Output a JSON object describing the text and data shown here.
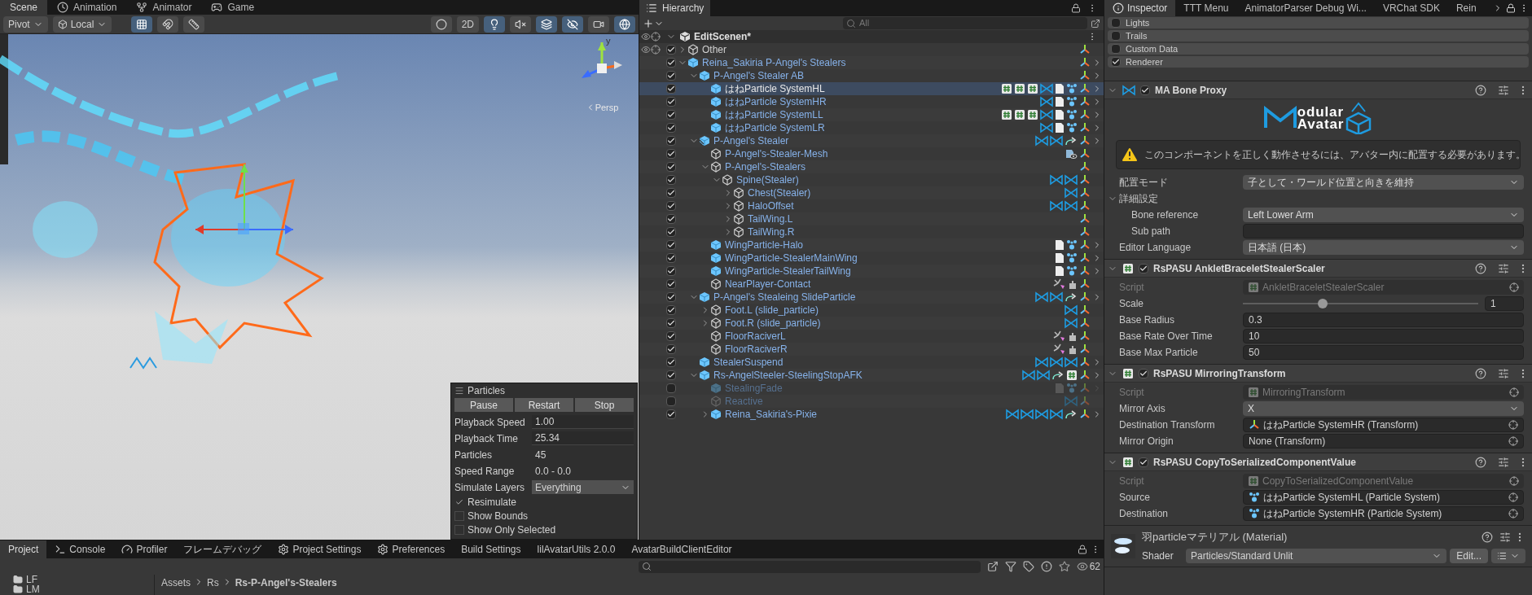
{
  "scene_view": {
    "tabs": [
      {
        "label": "Scene",
        "selected": true
      },
      {
        "label": "Animation",
        "selected": false
      },
      {
        "label": "Animator",
        "selected": false
      },
      {
        "label": "Game",
        "selected": false
      }
    ],
    "pivot": "Pivot",
    "space": "Local",
    "left_tools": [
      {
        "kind": "grid",
        "selected": true
      },
      {
        "kind": "snap",
        "selected": false
      },
      {
        "kind": "ruler",
        "selected": false
      }
    ],
    "right_tools": [
      {
        "kind": "shading",
        "selected": false
      },
      {
        "kind": "mode",
        "label": "2D",
        "selected": false
      },
      {
        "kind": "light",
        "selected": true
      },
      {
        "kind": "audio",
        "selected": false
      },
      {
        "kind": "effects",
        "selected": true
      },
      {
        "kind": "hidden",
        "selected": true
      },
      {
        "kind": "camera",
        "selected": false
      },
      {
        "kind": "gizmos",
        "selected": true
      }
    ],
    "gizmo": {
      "axis": "y",
      "projection": "Persp"
    },
    "particles_panel": {
      "title": "Particles",
      "buttons": [
        "Pause",
        "Restart",
        "Stop"
      ],
      "rows": [
        {
          "kind": "field",
          "label": "Playback Speed",
          "value": "1.00"
        },
        {
          "kind": "field",
          "label": "Playback Time",
          "value": "25.34"
        },
        {
          "kind": "text",
          "label": "Particles",
          "value": "45"
        },
        {
          "kind": "text",
          "label": "Speed Range",
          "value": "0.0 - 0.0"
        },
        {
          "kind": "dropdown",
          "label": "Simulate Layers",
          "value": "Everything"
        }
      ],
      "options": [
        {
          "label": "Resimulate",
          "checked": true
        },
        {
          "label": "Show Bounds",
          "checked": false
        },
        {
          "label": "Show Only Selected",
          "checked": false
        }
      ]
    }
  },
  "hierarchy": {
    "tab": "Hierarchy",
    "search": {
      "placeholder": "All"
    },
    "scene": {
      "name": "EditScenen*",
      "expanded": true,
      "children": [
        {
          "name": "Other",
          "kind": "object",
          "linked": false,
          "active": true,
          "selected": false,
          "expanded": false,
          "components": [
            {
              "kind": "transform"
            }
          ]
        },
        {
          "name": "Reina_Sakiria P-Angel's Stealers",
          "kind": "prefab",
          "linked": true,
          "active": true,
          "selected": false,
          "expanded": true,
          "components": [
            {
              "kind": "transform"
            }
          ],
          "children": [
            {
              "name": "P-Angel's Stealer AB",
              "kind": "prefab",
              "linked": true,
              "active": true,
              "selected": false,
              "expanded": true,
              "components": [
                {
                  "kind": "transform"
                }
              ],
              "children": [
                {
                  "name": "はねParticle SystemHL",
                  "kind": "prefab",
                  "linked": true,
                  "active": true,
                  "selected": true,
                  "components": [
                    {
                      "kind": "script"
                    },
                    {
                      "kind": "script"
                    },
                    {
                      "kind": "script"
                    },
                    {
                      "kind": "ma"
                    },
                    {
                      "kind": "doc"
                    },
                    {
                      "kind": "particle"
                    },
                    {
                      "kind": "transform"
                    }
                  ]
                },
                {
                  "name": "はねParticle SystemHR",
                  "kind": "prefab",
                  "linked": true,
                  "active": true,
                  "selected": false,
                  "components": [
                    {
                      "kind": "ma"
                    },
                    {
                      "kind": "doc"
                    },
                    {
                      "kind": "particle"
                    },
                    {
                      "kind": "transform"
                    }
                  ]
                },
                {
                  "name": "はねParticle SystemLL",
                  "kind": "prefab",
                  "linked": true,
                  "active": true,
                  "selected": false,
                  "components": [
                    {
                      "kind": "script"
                    },
                    {
                      "kind": "script"
                    },
                    {
                      "kind": "script"
                    },
                    {
                      "kind": "ma"
                    },
                    {
                      "kind": "doc"
                    },
                    {
                      "kind": "particle"
                    },
                    {
                      "kind": "transform"
                    }
                  ]
                },
                {
                  "name": "はねParticle SystemLR",
                  "kind": "prefab",
                  "linked": true,
                  "active": true,
                  "selected": false,
                  "components": [
                    {
                      "kind": "ma"
                    },
                    {
                      "kind": "doc"
                    },
                    {
                      "kind": "particle"
                    },
                    {
                      "kind": "transform"
                    }
                  ]
                }
              ]
            },
            {
              "name": "P-Angel's Stealer",
              "kind": "variant",
              "linked": true,
              "active": true,
              "selected": false,
              "expanded": true,
              "components": [
                {
                  "kind": "ma"
                },
                {
                  "kind": "ma"
                },
                {
                  "kind": "constraint"
                },
                {
                  "kind": "transform"
                }
              ],
              "children": [
                {
                  "name": "P-Angel's-Stealer-Mesh",
                  "kind": "object",
                  "linked": true,
                  "active": true,
                  "selected": false,
                  "components": [
                    {
                      "kind": "renderer"
                    },
                    {
                      "kind": "transform"
                    }
                  ]
                },
                {
                  "name": "P-Angel's-Stealers",
                  "kind": "object",
                  "linked": true,
                  "active": true,
                  "selected": false,
                  "expanded": true,
                  "components": [
                    {
                      "kind": "transform"
                    }
                  ],
                  "children": [
                    {
                      "name": "Spine(Stealer)",
                      "kind": "object",
                      "linked": true,
                      "active": true,
                      "selected": false,
                      "expanded": true,
                      "components": [
                        {
                          "kind": "ma"
                        },
                        {
                          "kind": "ma"
                        },
                        {
                          "kind": "transform"
                        }
                      ],
                      "children": [
                        {
                          "name": "Chest(Stealer)",
                          "kind": "object",
                          "linked": true,
                          "active": true,
                          "selected": false,
                          "expanded": false,
                          "components": [
                            {
                              "kind": "ma"
                            },
                            {
                              "kind": "transform"
                            }
                          ]
                        },
                        {
                          "name": "HaloOffset",
                          "kind": "object",
                          "linked": true,
                          "active": true,
                          "selected": false,
                          "expanded": false,
                          "components": [
                            {
                              "kind": "ma"
                            },
                            {
                              "kind": "ma"
                            },
                            {
                              "kind": "transform"
                            }
                          ]
                        },
                        {
                          "name": "TailWing.L",
                          "kind": "object",
                          "linked": true,
                          "active": true,
                          "selected": false,
                          "expanded": false,
                          "components": [
                            {
                              "kind": "transform"
                            }
                          ]
                        },
                        {
                          "name": "TailWing.R",
                          "kind": "object",
                          "linked": true,
                          "active": true,
                          "selected": false,
                          "expanded": false,
                          "components": [
                            {
                              "kind": "transform"
                            }
                          ]
                        }
                      ]
                    }
                  ]
                },
                {
                  "name": "WingParticle-Halo",
                  "kind": "prefab",
                  "linked": true,
                  "active": true,
                  "selected": false,
                  "components": [
                    {
                      "kind": "doc"
                    },
                    {
                      "kind": "particle"
                    },
                    {
                      "kind": "transform"
                    }
                  ]
                },
                {
                  "name": "WingParticle-StealerMainWing",
                  "kind": "prefab",
                  "linked": true,
                  "active": true,
                  "selected": false,
                  "components": [
                    {
                      "kind": "doc"
                    },
                    {
                      "kind": "particle"
                    },
                    {
                      "kind": "transform"
                    }
                  ]
                },
                {
                  "name": "WingParticle-StealerTailWing",
                  "kind": "prefab",
                  "linked": true,
                  "active": true,
                  "selected": false,
                  "components": [
                    {
                      "kind": "doc"
                    },
                    {
                      "kind": "particle"
                    },
                    {
                      "kind": "transform"
                    }
                  ]
                },
                {
                  "name": "NearPlayer-Contact",
                  "kind": "object",
                  "linked": true,
                  "active": true,
                  "selected": false,
                  "components": [
                    {
                      "kind": "contact"
                    },
                    {
                      "kind": "puzzle"
                    },
                    {
                      "kind": "transform"
                    }
                  ]
                }
              ]
            },
            {
              "name": "P-Angel's Stealeing SlideParticle",
              "kind": "prefab",
              "linked": true,
              "active": true,
              "selected": false,
              "expanded": true,
              "components": [
                {
                  "kind": "ma"
                },
                {
                  "kind": "ma"
                },
                {
                  "kind": "constraint"
                },
                {
                  "kind": "transform"
                }
              ],
              "children": [
                {
                  "name": "Foot.L (slide_particle)",
                  "kind": "object",
                  "linked": true,
                  "active": true,
                  "selected": false,
                  "expanded": false,
                  "components": [
                    {
                      "kind": "ma"
                    },
                    {
                      "kind": "transform"
                    }
                  ]
                },
                {
                  "name": "Foot.R (slide_particle)",
                  "kind": "object",
                  "linked": true,
                  "active": true,
                  "selected": false,
                  "expanded": false,
                  "components": [
                    {
                      "kind": "ma"
                    },
                    {
                      "kind": "transform"
                    }
                  ]
                },
                {
                  "name": "FloorRaciverL",
                  "kind": "object",
                  "linked": true,
                  "active": true,
                  "selected": false,
                  "components": [
                    {
                      "kind": "contact"
                    },
                    {
                      "kind": "puzzle"
                    },
                    {
                      "kind": "transform"
                    }
                  ]
                },
                {
                  "name": "FloorRaciverR",
                  "kind": "object",
                  "linked": true,
                  "active": true,
                  "selected": false,
                  "components": [
                    {
                      "kind": "contact"
                    },
                    {
                      "kind": "puzzle"
                    },
                    {
                      "kind": "transform"
                    }
                  ]
                }
              ]
            },
            {
              "name": "StealerSuspend",
              "kind": "prefab",
              "linked": true,
              "active": true,
              "selected": false,
              "components": [
                {
                  "kind": "ma"
                },
                {
                  "kind": "ma"
                },
                {
                  "kind": "ma"
                },
                {
                  "kind": "transform"
                }
              ]
            },
            {
              "name": "Rs-AngelSteeler-SteelingStopAFK",
              "kind": "prefab",
              "linked": true,
              "active": true,
              "selected": false,
              "expanded": true,
              "components": [
                {
                  "kind": "ma"
                },
                {
                  "kind": "ma"
                },
                {
                  "kind": "constraint"
                },
                {
                  "kind": "script"
                },
                {
                  "kind": "transform"
                }
              ],
              "children": [
                {
                  "name": "StealingFade",
                  "kind": "prefab",
                  "linked": true,
                  "active": false,
                  "selected": false,
                  "components": [
                    {
                      "kind": "doc"
                    },
                    {
                      "kind": "particle"
                    },
                    {
                      "kind": "transform"
                    }
                  ]
                },
                {
                  "name": "Reactive",
                  "kind": "object",
                  "linked": true,
                  "active": false,
                  "selected": false,
                  "components": [
                    {
                      "kind": "ma"
                    },
                    {
                      "kind": "transform"
                    }
                  ]
                },
                {
                  "name": "Reina_Sakiria's-Pixie",
                  "kind": "prefab",
                  "linked": true,
                  "active": true,
                  "selected": false,
                  "expanded": false,
                  "components": [
                    {
                      "kind": "ma"
                    },
                    {
                      "kind": "ma"
                    },
                    {
                      "kind": "ma"
                    },
                    {
                      "kind": "ma"
                    },
                    {
                      "kind": "constraint"
                    },
                    {
                      "kind": "transform"
                    }
                  ]
                }
              ]
            }
          ]
        }
      ]
    }
  },
  "inspector": {
    "tabs": [
      {
        "label": "Inspector",
        "selected": true
      },
      {
        "label": "TTT Menu",
        "selected": false
      },
      {
        "label": "AnimatorParser Debug Wi...",
        "selected": false
      },
      {
        "label": "VRChat SDK",
        "selected": false
      },
      {
        "label": "Rein",
        "selected": false
      }
    ],
    "modules": [
      {
        "label": "Lights",
        "checked": false
      },
      {
        "label": "Trails",
        "checked": false
      },
      {
        "label": "Custom Data",
        "checked": false
      },
      {
        "label": "Renderer",
        "checked": true
      }
    ],
    "components": [
      {
        "kind": "ma",
        "title": "MA Bone Proxy",
        "enabled": true,
        "logo": {
          "line_1": "odular",
          "line_2": "Avatar"
        },
        "warning": "このコンポーネントを正しく動作させるには、アバター内に配置する必要があります。",
        "fields": [
          {
            "kind": "dropdown",
            "label": "配置モード",
            "value": "子として・ワールド位置と向きを維持"
          },
          {
            "kind": "foldout",
            "label": "詳細設定",
            "expanded": true,
            "children": [
              {
                "kind": "dropdown",
                "label": "Bone reference",
                "value": "Left Lower Arm"
              },
              {
                "kind": "text",
                "label": "Sub path"
              }
            ]
          },
          {
            "kind": "dropdown",
            "label": "Editor Language",
            "value": "日本語 (日本)"
          }
        ]
      },
      {
        "kind": "script",
        "title": "RsPASU AnkletBraceletStealerScaler",
        "enabled": true,
        "fields": [
          {
            "kind": "script",
            "label": "Script",
            "value": "AnkletBraceletStealerScaler"
          },
          {
            "kind": "slider",
            "label": "Scale",
            "level": 0.34,
            "value": "1"
          },
          {
            "kind": "text",
            "label": "Base Radius",
            "value": "0.3"
          },
          {
            "kind": "text",
            "label": "Base Rate Over Time",
            "value": "10"
          },
          {
            "kind": "text",
            "label": "Base Max Particle",
            "value": "50"
          }
        ]
      },
      {
        "kind": "script",
        "title": "RsPASU MirroringTransform",
        "enabled": true,
        "fields": [
          {
            "kind": "script",
            "label": "Script",
            "value": "MirroringTransform"
          },
          {
            "kind": "dropdown",
            "label": "Mirror Axis",
            "value": "X"
          },
          {
            "kind": "transform",
            "label": "Destination Transform",
            "value": "はねParticle SystemHR (Transform)"
          },
          {
            "kind": "object",
            "label": "Mirror Origin",
            "value": "None (Transform)"
          }
        ]
      },
      {
        "kind": "script",
        "title": "RsPASU CopyToSerializedComponentValue",
        "enabled": true,
        "fields": [
          {
            "kind": "script",
            "label": "Script",
            "value": "CopyToSerializedComponentValue"
          },
          {
            "kind": "particle",
            "label": "Source",
            "value": "はねParticle SystemHL (Particle System)"
          },
          {
            "kind": "particle",
            "label": "Destination",
            "value": "はねParticle SystemHR (Particle System)"
          }
        ]
      }
    ],
    "material": {
      "name": "羽particleマテリアル (Material)",
      "shader_label": "Shader",
      "shader": "Particles/Standard Unlit",
      "edit_button": "Edit..."
    }
  },
  "project": {
    "tabs": [
      {
        "label": "Project",
        "selected": true
      },
      {
        "label": "Console",
        "selected": false
      },
      {
        "label": "Profiler",
        "selected": false
      },
      {
        "label": "フレームデバッグ",
        "selected": false
      },
      {
        "label": "Project Settings",
        "selected": false
      },
      {
        "label": "Preferences",
        "selected": false
      },
      {
        "label": "Build Settings",
        "selected": false
      },
      {
        "label": "lilAvatarUtils 2.0.0",
        "selected": false
      },
      {
        "label": "AvatarBuildClientEditor",
        "selected": false
      }
    ],
    "hidden_count": "62",
    "folders": [
      "LF",
      "LM"
    ],
    "breadcrumb": [
      "Assets",
      "Rs",
      "Rs-P-Angel's-Stealers"
    ]
  }
}
